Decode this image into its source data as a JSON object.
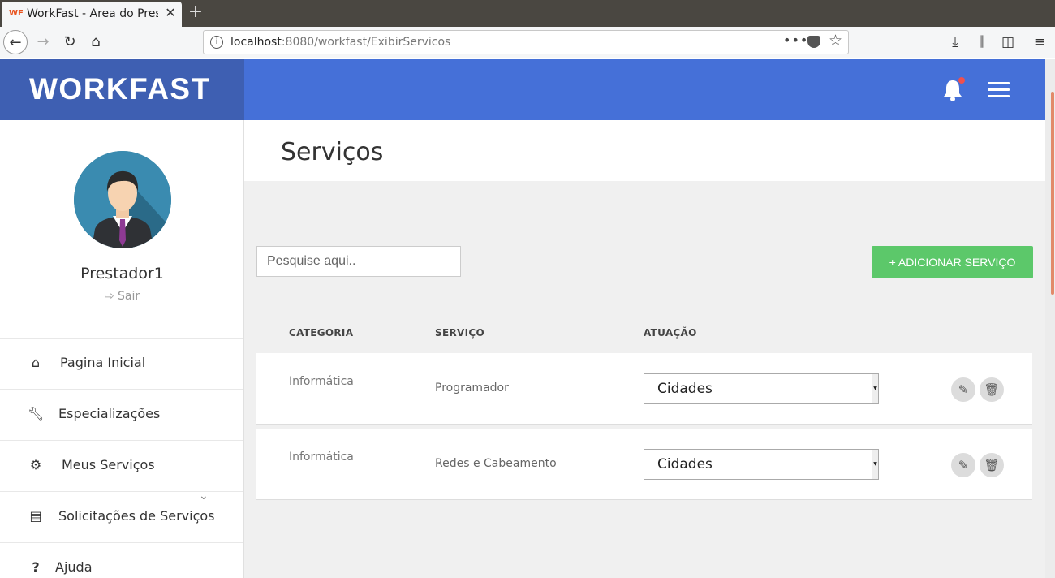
{
  "browser": {
    "tab_title": "WorkFast - Area do Prestador",
    "tab_favicon": "WF",
    "url_host": "localhost",
    "url_rest": ":8080/workfast/ExibirServicos"
  },
  "brand": {
    "name": "WORKFAST"
  },
  "user": {
    "name": "Prestador1",
    "logout_label": "Sair"
  },
  "menu": {
    "items": [
      {
        "label": "Pagina Inicial",
        "icon": "home-icon"
      },
      {
        "label": "Especializações",
        "icon": "wrench-icon"
      },
      {
        "label": "Meus Serviços",
        "icon": "gears-icon"
      },
      {
        "label": "Solicitações de Serviços",
        "icon": "list-icon"
      },
      {
        "label": "Ajuda",
        "icon": "question-icon"
      }
    ]
  },
  "main": {
    "title": "Serviços",
    "search_placeholder": "Pesquise aqui..",
    "add_button": "+ ADICIONAR SERVIÇO",
    "table": {
      "headers": [
        "CATEGORIA",
        "SERVIÇO",
        "ATUAÇÃO"
      ],
      "rows": [
        {
          "categoria": "Informática",
          "servico": "Programador",
          "atuacao": "Cidades"
        },
        {
          "categoria": "Informática",
          "servico": "Redes e Cabeamento",
          "atuacao": "Cidades"
        }
      ]
    }
  },
  "colors": {
    "topbar": "#4570d8",
    "brand_bg": "#3e5fb2",
    "add_button": "#5cc86a"
  }
}
